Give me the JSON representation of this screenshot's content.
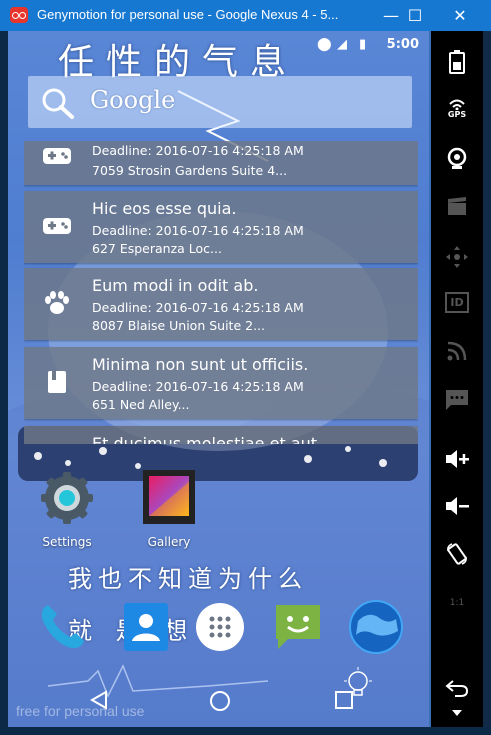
{
  "window": {
    "title": "Genymotion for personal use - Google Nexus 4 - 5...",
    "minimize": "—",
    "maximize": "☐",
    "close": "✕"
  },
  "statusbar": {
    "time": "5:00"
  },
  "wallpaper": {
    "top_text": "任性的气息",
    "middle_text": "我也不知道为什么",
    "dock_text": "就 是 想"
  },
  "search": {
    "logo_text": "Google"
  },
  "tasks": [
    {
      "title": "",
      "deadline": "Deadline: 2016-07-16 4:25:18 AM",
      "address": "7059 Strosin Gardens Suite 4...",
      "icon": "gamepad-icon"
    },
    {
      "title": "Hic eos esse quia.",
      "deadline": "Deadline: 2016-07-16 4:25:18 AM",
      "address": "627 Esperanza Loc...",
      "icon": "gamepad-icon"
    },
    {
      "title": "Eum modi in odit ab.",
      "deadline": "Deadline: 2016-07-16 4:25:18 AM",
      "address": "8087 Blaise Union Suite 2...",
      "icon": "paw-icon"
    },
    {
      "title": "Minima non sunt ut officiis.",
      "deadline": "Deadline: 2016-07-16 4:25:18 AM",
      "address": "651 Ned Alley...",
      "icon": "book-icon"
    },
    {
      "title": "Et ducimus molestiae et aut",
      "deadline": "",
      "address": "",
      "icon": ""
    }
  ],
  "apps": {
    "settings": "Settings",
    "gallery": "Gallery"
  },
  "watermark": "free for personal use",
  "toolbar": {
    "gps_label": "GPS",
    "id_label": "ID",
    "scale_label": "1:1"
  },
  "colors": {
    "titlebar": "#1778d2",
    "close_red": "#e7352b",
    "card_bg": "#6e7887"
  }
}
